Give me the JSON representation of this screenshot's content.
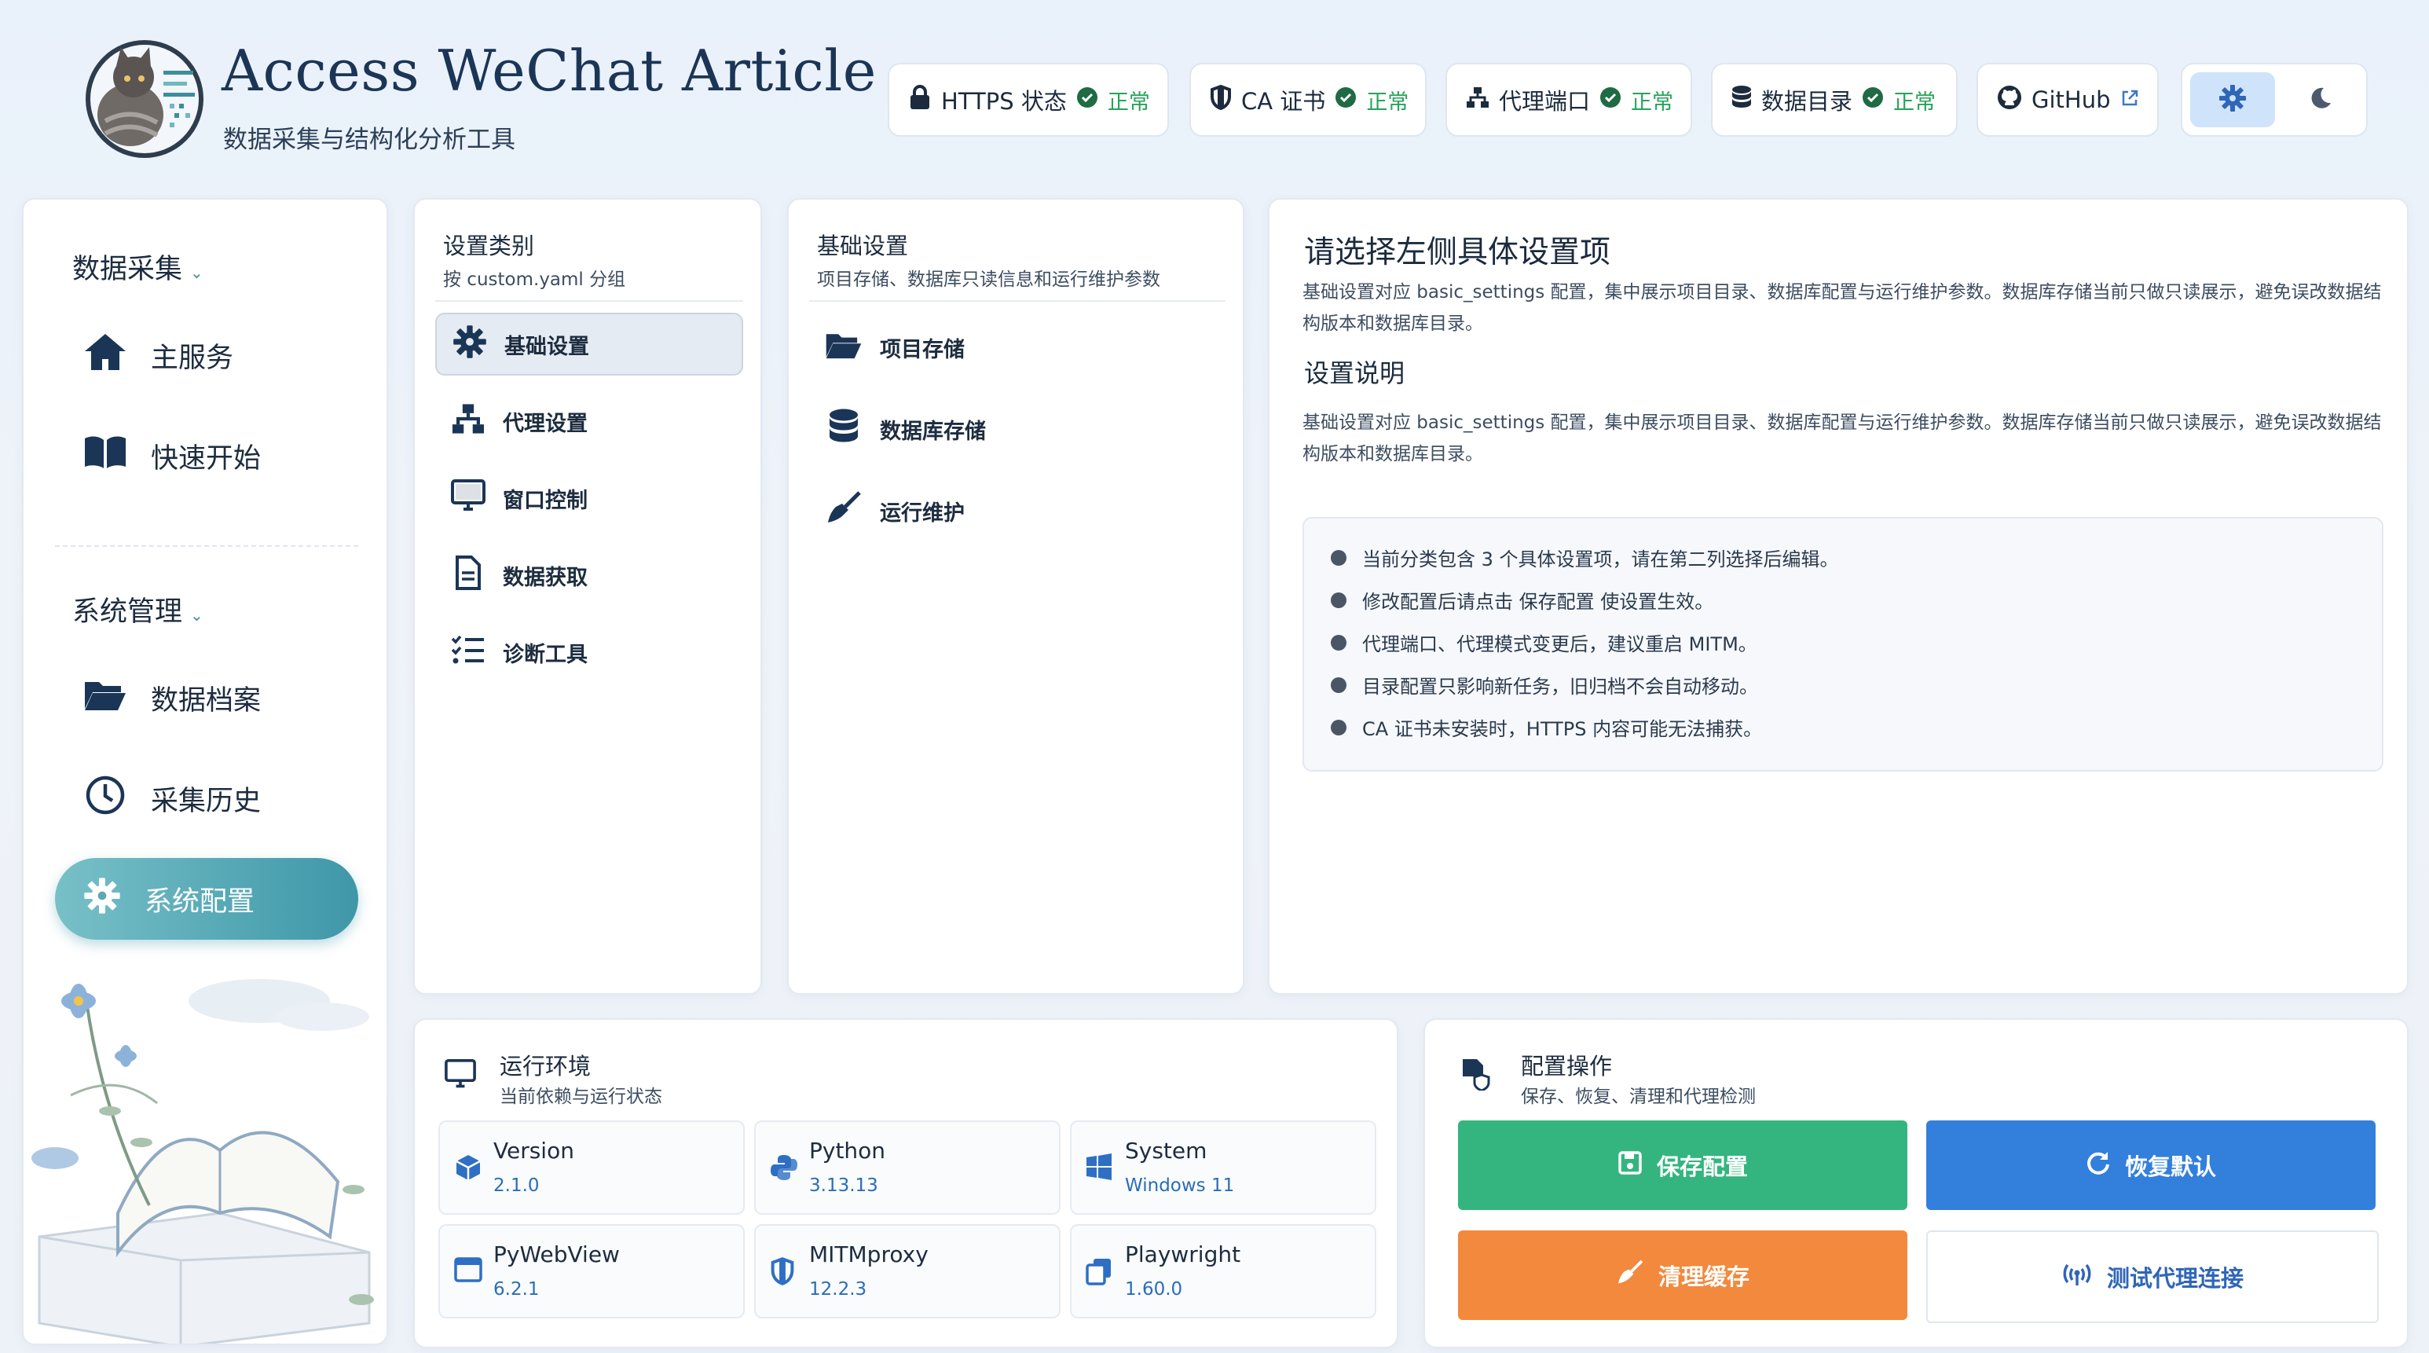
{
  "app": {
    "title": "Access WeChat Article",
    "subtitle": "数据采集与结构化分析工具"
  },
  "status_bar": [
    {
      "label": "HTTPS 状态",
      "status": "正常",
      "icon": "lock-icon"
    },
    {
      "label": "CA 证书",
      "status": "正常",
      "icon": "shield-icon"
    },
    {
      "label": "代理端口",
      "status": "正常",
      "icon": "network-icon"
    },
    {
      "label": "数据目录",
      "status": "正常",
      "icon": "database-icon"
    }
  ],
  "github": {
    "label": "GitHub",
    "icon": "github-icon"
  },
  "theme": {
    "light_icon": "gear-icon",
    "dark_icon": "moon-icon",
    "active": "light"
  },
  "sidebar": {
    "sections": [
      {
        "title": "数据采集",
        "items": [
          {
            "label": "主服务",
            "icon": "home-icon"
          },
          {
            "label": "快速开始",
            "icon": "book-icon"
          }
        ]
      },
      {
        "title": "系统管理",
        "items": [
          {
            "label": "数据档案",
            "icon": "folder-open-icon"
          },
          {
            "label": "采集历史",
            "icon": "clock-icon"
          },
          {
            "label": "系统配置",
            "icon": "gear-icon",
            "active": true
          }
        ]
      }
    ]
  },
  "categories": {
    "title": "设置类别",
    "subtitle": "按 custom.yaml 分组",
    "items": [
      {
        "label": "基础设置",
        "icon": "gear-icon",
        "active": true
      },
      {
        "label": "代理设置",
        "icon": "network-icon"
      },
      {
        "label": "窗口控制",
        "icon": "monitor-icon"
      },
      {
        "label": "数据获取",
        "icon": "file-icon"
      },
      {
        "label": "诊断工具",
        "icon": "checklist-icon"
      }
    ]
  },
  "basic": {
    "title": "基础设置",
    "subtitle": "项目存储、数据库只读信息和运行维护参数",
    "items": [
      {
        "label": "项目存储",
        "icon": "folder-open-icon"
      },
      {
        "label": "数据库存储",
        "icon": "database-icon"
      },
      {
        "label": "运行维护",
        "icon": "broom-icon"
      }
    ]
  },
  "info": {
    "title": "请选择左侧具体设置项",
    "desc": "基础设置对应 basic_settings 配置，集中展示项目目录、数据库配置与运行维护参数。数据库存储当前只做只读展示，避免误改数据结构版本和数据库目录。",
    "section_title": "设置说明",
    "section_desc": "基础设置对应 basic_settings 配置，集中展示项目目录、数据库配置与运行维护参数。数据库存储当前只做只读展示，避免误改数据结构版本和数据库目录。",
    "tips": [
      "当前分类包含 3 个具体设置项，请在第二列选择后编辑。",
      "修改配置后请点击 保存配置 使设置生效。",
      "代理端口、代理模式变更后，建议重启 MITM。",
      "目录配置只影响新任务，旧归档不会自动移动。",
      "CA 证书未安装时，HTTPS 内容可能无法捕获。"
    ]
  },
  "env": {
    "title": "运行环境",
    "subtitle": "当前依赖与运行状态",
    "items": [
      {
        "name": "Version",
        "value": "2.1.0",
        "icon": "cube-icon"
      },
      {
        "name": "Python",
        "value": "3.13.13",
        "icon": "python-icon"
      },
      {
        "name": "System",
        "value": "Windows 11",
        "icon": "windows-icon"
      },
      {
        "name": "PyWebView",
        "value": "6.2.1",
        "icon": "window-icon"
      },
      {
        "name": "MITMproxy",
        "value": "12.2.3",
        "icon": "shield-icon"
      },
      {
        "name": "Playwright",
        "value": "1.60.0",
        "icon": "copy-icon"
      }
    ]
  },
  "ops": {
    "title": "配置操作",
    "subtitle": "保存、恢复、清理和代理检测",
    "buttons": [
      {
        "label": "保存配置",
        "icon": "save-icon",
        "color": "#34b57f"
      },
      {
        "label": "恢复默认",
        "icon": "refresh-icon",
        "color": "#337fdc"
      },
      {
        "label": "清理缓存",
        "icon": "broom-icon",
        "color": "#f2893c"
      },
      {
        "label": "测试代理连接",
        "icon": "antenna-icon",
        "color": "#ffffff"
      }
    ]
  }
}
